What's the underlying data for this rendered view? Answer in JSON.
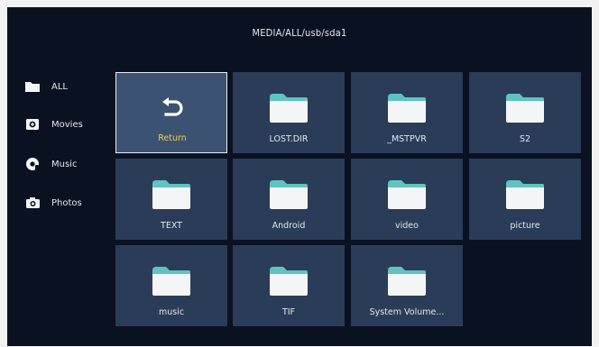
{
  "header": {
    "path": "MEDIA/ALL/usb/sda1"
  },
  "sidebar": {
    "items": [
      {
        "label": "ALL",
        "icon": "folder-icon"
      },
      {
        "label": "Movies",
        "icon": "movie-icon"
      },
      {
        "label": "Music",
        "icon": "music-icon"
      },
      {
        "label": "Photos",
        "icon": "camera-icon"
      }
    ]
  },
  "grid": {
    "items": [
      {
        "label": "Return",
        "icon": "return-icon",
        "selected": true
      },
      {
        "label": "LOST.DIR",
        "icon": "folder-icon"
      },
      {
        "label": "_MSTPVR",
        "icon": "folder-icon"
      },
      {
        "label": "S2",
        "icon": "folder-icon"
      },
      {
        "label": "TEXT",
        "icon": "folder-icon"
      },
      {
        "label": "Android",
        "icon": "folder-icon"
      },
      {
        "label": "video",
        "icon": "folder-icon"
      },
      {
        "label": "picture",
        "icon": "folder-icon"
      },
      {
        "label": "music",
        "icon": "folder-icon"
      },
      {
        "label": "TIF",
        "icon": "folder-icon"
      },
      {
        "label": "System Volume...",
        "icon": "folder-icon"
      }
    ]
  },
  "colors": {
    "background": "#0a1221",
    "tile": "#2a3c58",
    "tile_selected": "#3c5272",
    "selected_label": "#f2cf45",
    "folder_tab": "#5fc4c0",
    "folder_body": "#f4f5f7"
  }
}
